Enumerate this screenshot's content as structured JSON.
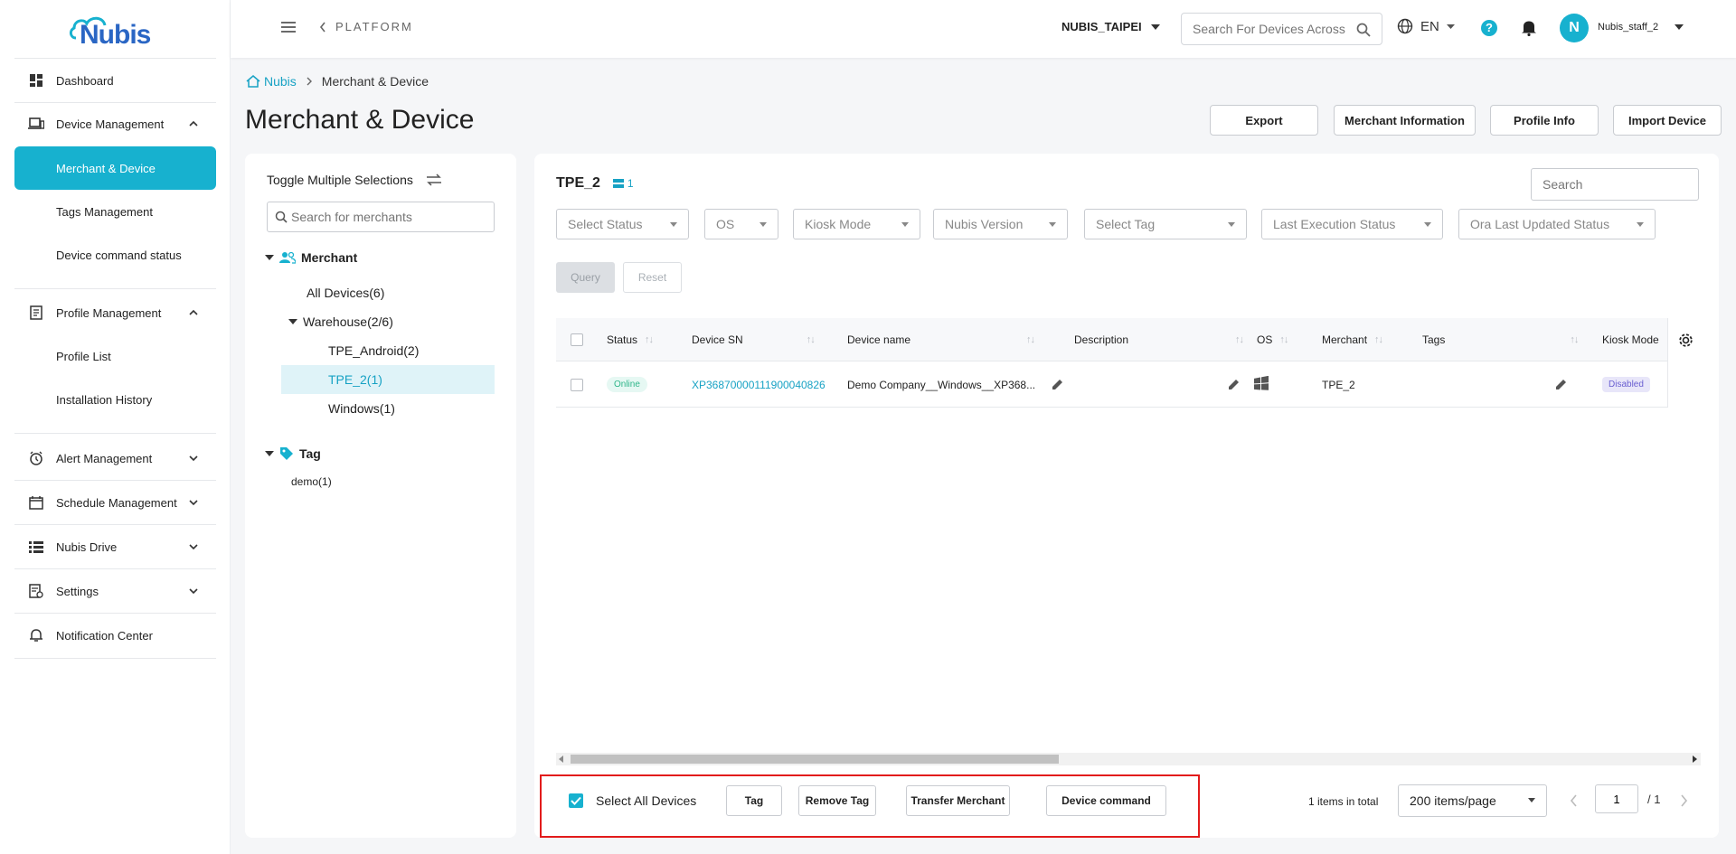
{
  "app": {
    "logo_text": "Nubis"
  },
  "topbar": {
    "platform_label": "PLATFORM",
    "tenant": "NUBIS_TAIPEI",
    "search_placeholder": "Search For Devices Across",
    "language": "EN",
    "help": "?",
    "avatar_initial": "N",
    "username": "Nubis_staff_2"
  },
  "sidebar": {
    "dashboard": "Dashboard",
    "device_management": "Device Management",
    "merchant_device": "Merchant & Device",
    "tags_management": "Tags Management",
    "device_command_status": "Device command status",
    "profile_management": "Profile Management",
    "profile_list": "Profile List",
    "installation_history": "Installation History",
    "alert_management": "Alert Management",
    "schedule_management": "Schedule Management",
    "nubis_drive": "Nubis Drive",
    "settings": "Settings",
    "notification_center": "Notification Center"
  },
  "breadcrumb": {
    "home": "Nubis",
    "current": "Merchant & Device"
  },
  "page": {
    "title": "Merchant & Device"
  },
  "header_buttons": {
    "export": "Export",
    "merchant_info": "Merchant Information",
    "profile_info": "Profile Info",
    "import_device": "Import Device"
  },
  "left_panel": {
    "toggle_label": "Toggle Multiple Selections",
    "search_placeholder": "Search for merchants",
    "merchant_heading": "Merchant",
    "all_devices": "All Devices(6)",
    "warehouse": "Warehouse(2/6)",
    "tpe_android": "TPE_Android(2)",
    "tpe_2": "TPE_2(1)",
    "windows": "Windows(1)",
    "tag_heading": "Tag",
    "demo": "demo(1)"
  },
  "main": {
    "title": "TPE_2",
    "device_count": "1",
    "search_placeholder": "Search",
    "filters": {
      "status": "Select Status",
      "os": "OS",
      "kiosk": "Kiosk Mode",
      "version": "Nubis Version",
      "tag": "Select Tag",
      "last_exec": "Last Execution Status",
      "ora": "Ora Last Updated Status"
    },
    "query": "Query",
    "reset": "Reset",
    "columns": {
      "status": "Status",
      "device_sn": "Device SN",
      "device_name": "Device name",
      "description": "Description",
      "os": "OS",
      "merchant": "Merchant",
      "tags": "Tags",
      "kiosk_mode": "Kiosk Mode"
    },
    "rows": [
      {
        "status": "Online",
        "device_sn": "XP36870000111900040826",
        "device_name": "Demo Company__Windows__XP368...",
        "description": "",
        "merchant": "TPE_2",
        "tags": "",
        "kiosk_mode": "Disabled"
      }
    ]
  },
  "footer": {
    "select_all": "Select All Devices",
    "tag": "Tag",
    "remove_tag": "Remove Tag",
    "transfer_merchant": "Transfer Merchant",
    "device_command": "Device command",
    "total": "1 items in total",
    "page_size": "200 items/page",
    "page": "1",
    "page_total": "/ 1"
  },
  "colors": {
    "accent": "#17b1cf",
    "highlight_border": "#e21b1b"
  }
}
